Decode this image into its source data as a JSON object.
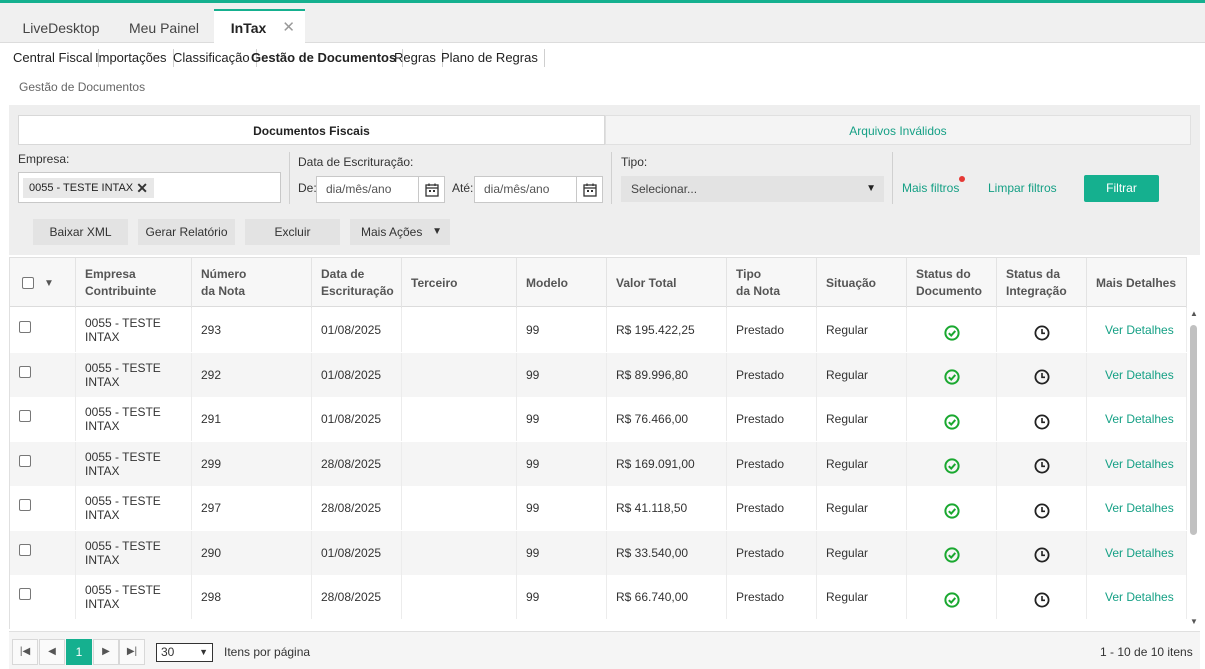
{
  "app_tabs": [
    {
      "label": "LiveDesktop"
    },
    {
      "label": "Meu Painel"
    },
    {
      "label": "InTax",
      "close": "✕"
    }
  ],
  "module_nav": [
    "Central Fiscal",
    "Importações",
    "Classificação",
    "Gestão de Documentos",
    "Regras",
    "Plano de Regras"
  ],
  "breadcrumb": "Gestão de Documentos",
  "section_tabs": {
    "fiscal": "Documentos Fiscais",
    "invalid": "Arquivos Inválidos"
  },
  "filters": {
    "empresa_label": "Empresa:",
    "empresa_chip": "0055 - TESTE INTAX",
    "chip_remove": "✕",
    "data_label": "Data de Escrituração:",
    "de_label": "De:",
    "ate_label": "Até:",
    "date_placeholder": "dia/mês/ano",
    "tipo_label": "Tipo:",
    "tipo_value": "Selecionar...",
    "mais_filtros": "Mais filtros",
    "limpar_filtros": "Limpar filtros",
    "filtrar": "Filtrar"
  },
  "actions": {
    "baixar": "Baixar XML",
    "gerar": "Gerar Relatório",
    "excluir": "Excluir",
    "mais": "Mais Ações"
  },
  "table": {
    "headers": [
      {
        "l1": "Empresa",
        "l2": "Contribuinte"
      },
      {
        "l1": "Número",
        "l2": "da Nota"
      },
      {
        "l1": "Data de",
        "l2": "Escrituração"
      },
      {
        "l1": "Terceiro",
        "l2": ""
      },
      {
        "l1": "Modelo",
        "l2": ""
      },
      {
        "l1": "Valor Total",
        "l2": ""
      },
      {
        "l1": "Tipo",
        "l2": "da Nota"
      },
      {
        "l1": "Situação",
        "l2": ""
      },
      {
        "l1": "Status do",
        "l2": "Documento"
      },
      {
        "l1": "Status da",
        "l2": "Integração"
      },
      {
        "l1": "Mais Detalhes",
        "l2": ""
      }
    ],
    "rows": [
      {
        "empresa": "0055 - TESTE INTAX",
        "numero": "293",
        "data": "01/08/2025",
        "terceiro": "",
        "modelo": "99",
        "valor": "R$ 195.422,25",
        "tipo": "Prestado",
        "situacao": "Regular",
        "detalhes": "Ver Detalhes"
      },
      {
        "empresa": "0055 - TESTE INTAX",
        "numero": "292",
        "data": "01/08/2025",
        "terceiro": "",
        "modelo": "99",
        "valor": "R$ 89.996,80",
        "tipo": "Prestado",
        "situacao": "Regular",
        "detalhes": "Ver Detalhes"
      },
      {
        "empresa": "0055 - TESTE INTAX",
        "numero": "291",
        "data": "01/08/2025",
        "terceiro": "",
        "modelo": "99",
        "valor": "R$ 76.466,00",
        "tipo": "Prestado",
        "situacao": "Regular",
        "detalhes": "Ver Detalhes"
      },
      {
        "empresa": "0055 - TESTE INTAX",
        "numero": "299",
        "data": "28/08/2025",
        "terceiro": "",
        "modelo": "99",
        "valor": "R$ 169.091,00",
        "tipo": "Prestado",
        "situacao": "Regular",
        "detalhes": "Ver Detalhes"
      },
      {
        "empresa": "0055 - TESTE INTAX",
        "numero": "297",
        "data": "28/08/2025",
        "terceiro": "",
        "modelo": "99",
        "valor": "R$ 41.118,50",
        "tipo": "Prestado",
        "situacao": "Regular",
        "detalhes": "Ver Detalhes"
      },
      {
        "empresa": "0055 - TESTE INTAX",
        "numero": "290",
        "data": "01/08/2025",
        "terceiro": "",
        "modelo": "99",
        "valor": "R$ 33.540,00",
        "tipo": "Prestado",
        "situacao": "Regular",
        "detalhes": "Ver Detalhes"
      },
      {
        "empresa": "0055 - TESTE INTAX",
        "numero": "298",
        "data": "28/08/2025",
        "terceiro": "",
        "modelo": "99",
        "valor": "R$ 66.740,00",
        "tipo": "Prestado",
        "situacao": "Regular",
        "detalhes": "Ver Detalhes"
      }
    ]
  },
  "pager": {
    "current": "1",
    "per_page": "30",
    "per_page_label": "Itens por página",
    "summary": "1 - 10 de 10 itens"
  },
  "colors": {
    "accent": "#15b08f",
    "link": "#15a085",
    "ok": "#1aa830",
    "dot": "#e53935"
  }
}
